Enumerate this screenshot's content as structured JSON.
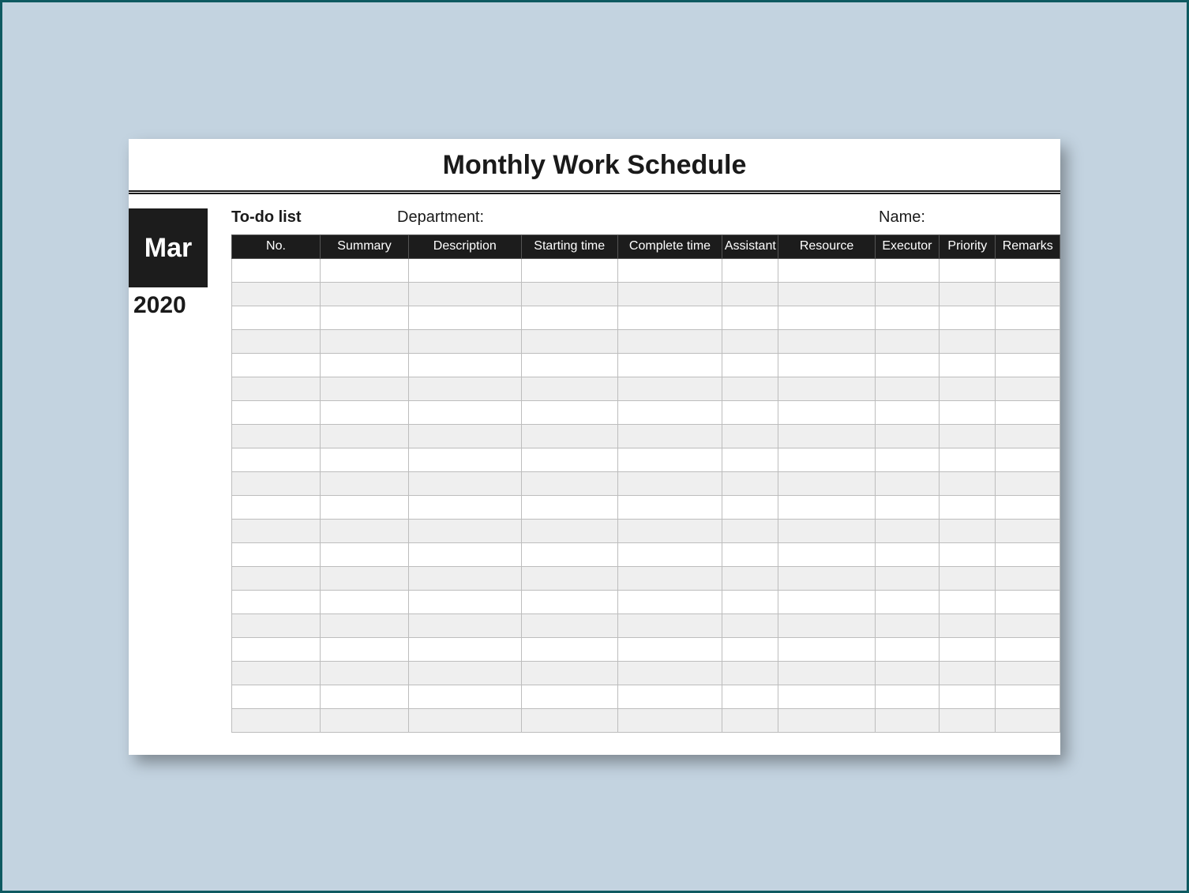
{
  "title": "Monthly Work Schedule",
  "sidebar": {
    "month": "Mar",
    "year": "2020"
  },
  "labels": {
    "todo": "To-do list",
    "department": "Department:",
    "name": "Name:"
  },
  "columns": [
    "No.",
    "Summary",
    "Description",
    "Starting time",
    "Complete time",
    "Assistant",
    "Resource",
    "Executor",
    "Priority",
    "Remarks"
  ],
  "row_count": 20
}
